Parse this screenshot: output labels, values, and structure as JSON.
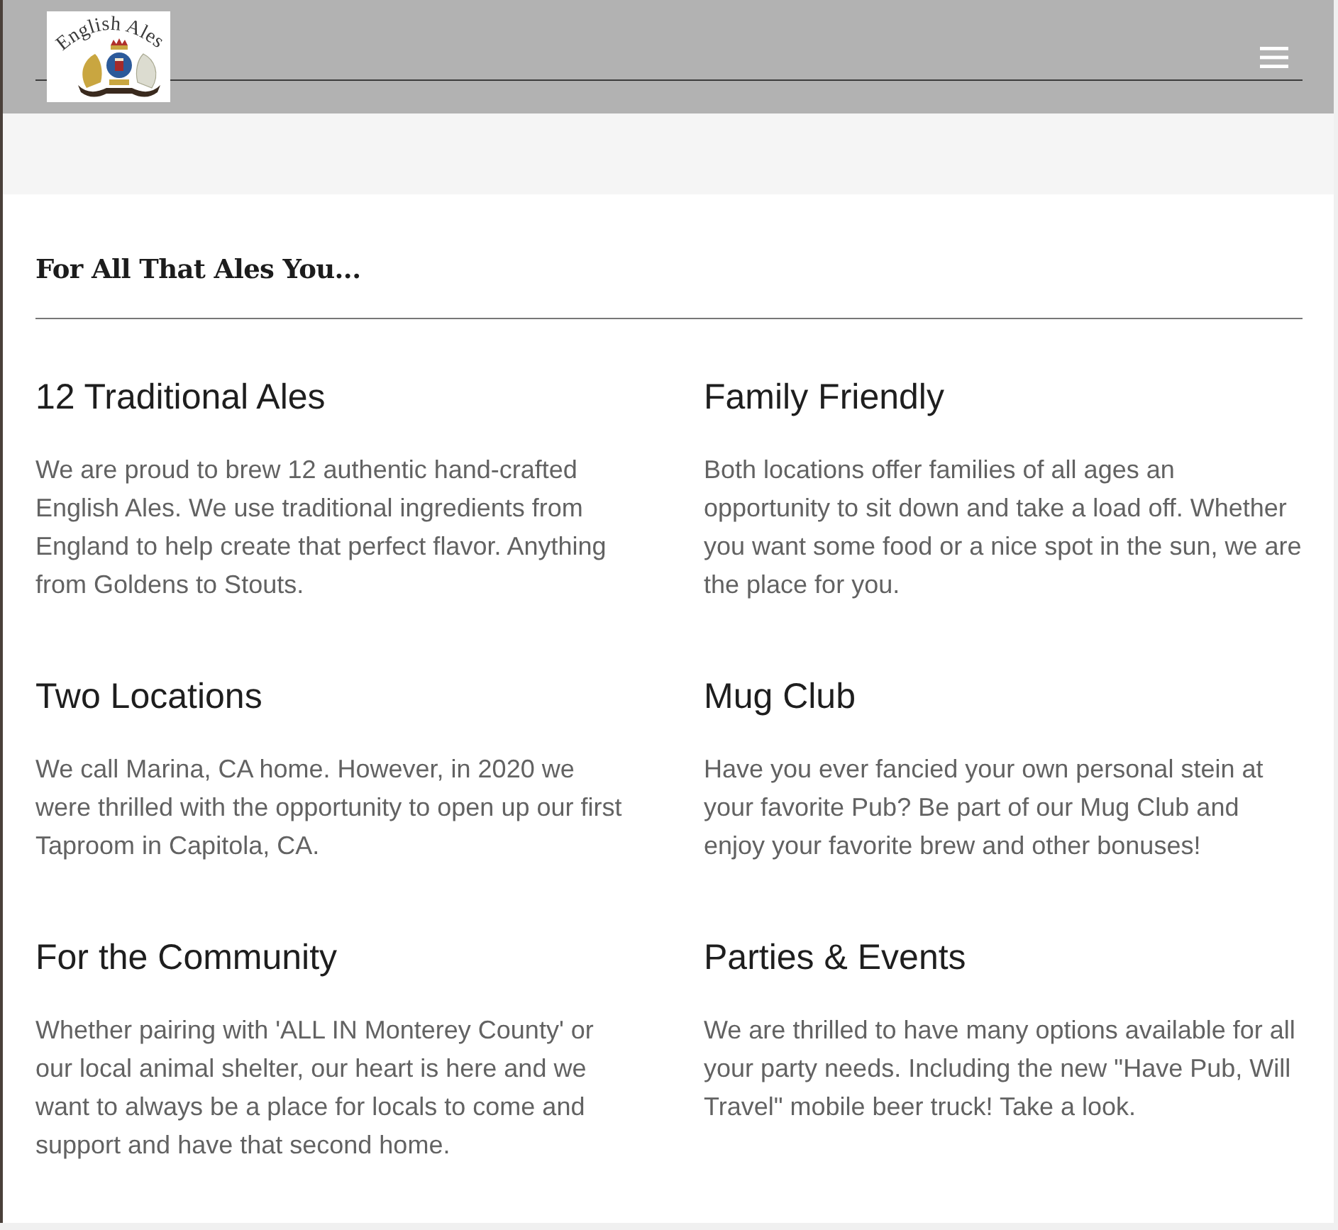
{
  "header": {
    "logo_text": "English Ales"
  },
  "section": {
    "title": "For All That Ales You...",
    "features": [
      {
        "heading": "12 Traditional Ales",
        "text": "We are proud to brew 12 authentic hand-crafted English Ales. We use traditional ingredients from England to help create that perfect flavor. Anything from Goldens to Stouts."
      },
      {
        "heading": "Family Friendly",
        "text": "Both locations offer families of all ages an opportunity to sit down and take a load off. Whether you want some food or a nice spot in the sun, we are the place for you."
      },
      {
        "heading": "Two Locations",
        "text": "We call Marina, CA home. However, in 2020 we were thrilled with the opportunity to open up our first Taproom in Capitola, CA."
      },
      {
        "heading": "Mug Club",
        "text": "Have you ever fancied your own personal stein at your favorite Pub? Be part of our Mug Club and enjoy your favorite brew and other bonuses!"
      },
      {
        "heading": "For the Community",
        "text": "Whether pairing with 'ALL IN Monterey County' or our local animal shelter, our heart is here and we want to always be a place for locals to come and support and have that second home."
      },
      {
        "heading": "Parties & Events",
        "text": "We are thrilled to have many options available for all your party needs. Including the new \"Have Pub, Will Travel\" mobile beer truck! Take a look."
      }
    ]
  }
}
